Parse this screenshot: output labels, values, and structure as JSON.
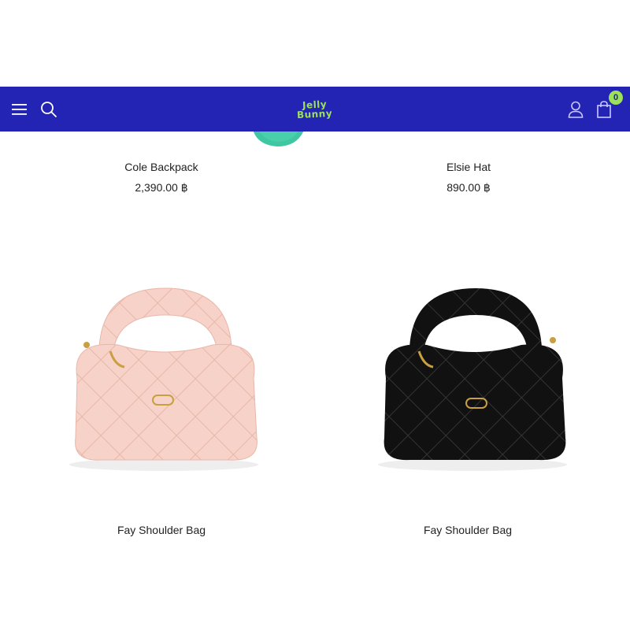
{
  "header": {
    "logo_line1": "Jelly",
    "logo_line2": "Bunny",
    "cart_count": "0",
    "icons": [
      "menu-icon",
      "search-icon",
      "user-icon",
      "shopping-bag-icon"
    ],
    "background_color": "#2424b4",
    "accent_color": "#9be25a"
  },
  "products": [
    {
      "name": "Cole Backpack",
      "price": "2,390.00 ฿"
    },
    {
      "name": "Elsie Hat",
      "price": "890.00 ฿"
    },
    {
      "name": "Fay Shoulder Bag",
      "price": "",
      "image_color": "#f6d2c8"
    },
    {
      "name": "Fay Shoulder Bag",
      "price": "",
      "image_color": "#111111"
    }
  ]
}
